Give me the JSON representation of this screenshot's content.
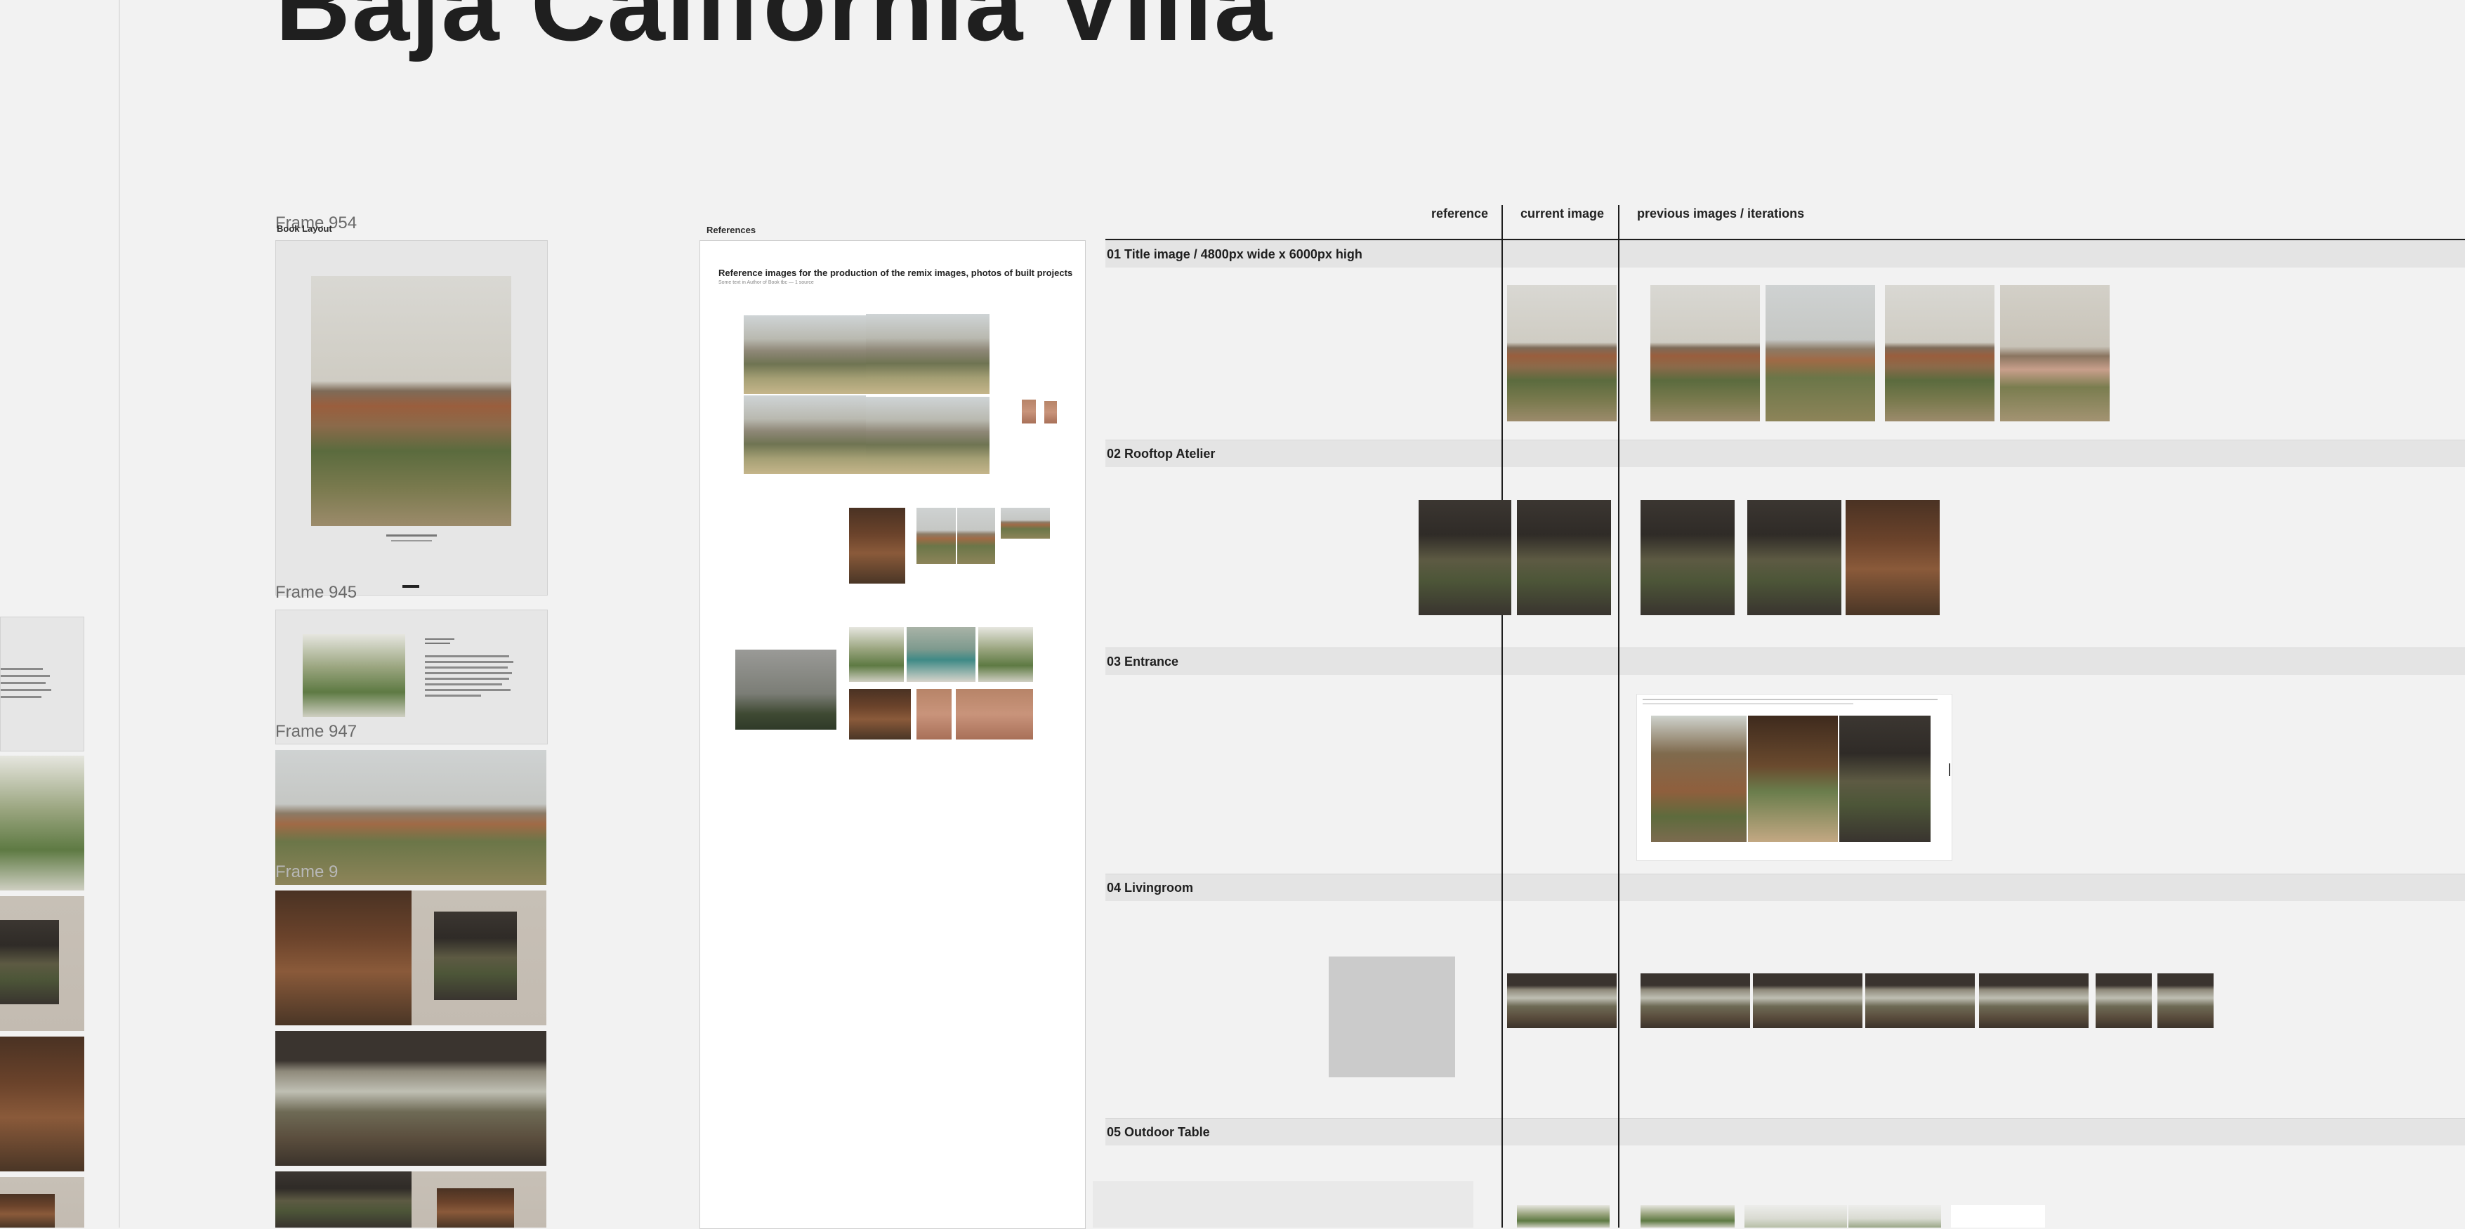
{
  "canvas": {
    "title": "Baja California Villa"
  },
  "frames": {
    "frame954": "Frame 954",
    "book_layout": "Book Layout",
    "frame945": "Frame 945",
    "frame947": "Frame 947",
    "frame_faded": "Frame 9"
  },
  "references_panel": {
    "label": "References",
    "heading": "Reference images for the production of the remix images, photos of built projects",
    "subheading": "Some text in Author of Book tbc — 1 source"
  },
  "table": {
    "columns": {
      "reference": "reference",
      "current": "current image",
      "previous": "previous images / iterations"
    },
    "rows": [
      {
        "label": "01 Title image / 4800px wide x 6000px high"
      },
      {
        "label": "02 Rooftop Atelier"
      },
      {
        "label": "03 Entrance"
      },
      {
        "label": "04 Livingroom"
      },
      {
        "label": "05 Outdoor Table"
      }
    ]
  },
  "icons": {
    "drag_handle": "drag-handle-icon"
  }
}
